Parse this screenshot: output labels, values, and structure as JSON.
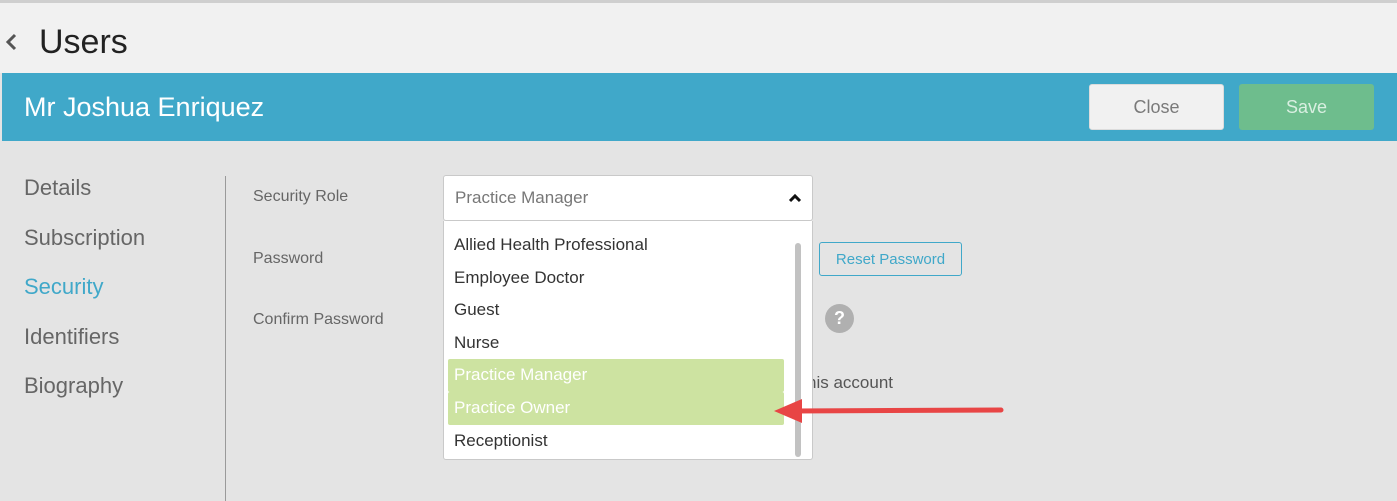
{
  "page": {
    "title": "Users"
  },
  "header": {
    "user_name": "Mr Joshua Enriquez",
    "close_label": "Close",
    "save_label": "Save"
  },
  "sidebar": {
    "items": [
      {
        "label": "Details",
        "active": false
      },
      {
        "label": "Subscription",
        "active": false
      },
      {
        "label": "Security",
        "active": true
      },
      {
        "label": "Identifiers",
        "active": false
      },
      {
        "label": "Biography",
        "active": false
      }
    ]
  },
  "form": {
    "security_role_label": "Security Role",
    "password_label": "Password",
    "confirm_password_label": "Confirm Password",
    "security_role_value": "Practice Manager",
    "reset_password_label": "Reset Password",
    "help_glyph": "?",
    "partial_checkbox_text": "his account"
  },
  "dropdown": {
    "options": [
      {
        "label": "Allied Health Professional",
        "highlighted": false
      },
      {
        "label": "Employee Doctor",
        "highlighted": false
      },
      {
        "label": "Guest",
        "highlighted": false
      },
      {
        "label": "Nurse",
        "highlighted": false
      },
      {
        "label": "Practice Manager",
        "highlighted": true
      },
      {
        "label": "Practice Owner",
        "highlighted": true
      },
      {
        "label": "Receptionist",
        "highlighted": false
      }
    ]
  },
  "colors": {
    "accent": "#40a8c9",
    "save": "#6ebd8d",
    "highlight": "#cde3a1",
    "annotation_arrow": "#e84545"
  },
  "icons": {
    "back": "chevron-left-icon",
    "dropdown_toggle": "chevron-up-icon",
    "help": "help-icon",
    "annotation": "red-arrow-icon"
  }
}
